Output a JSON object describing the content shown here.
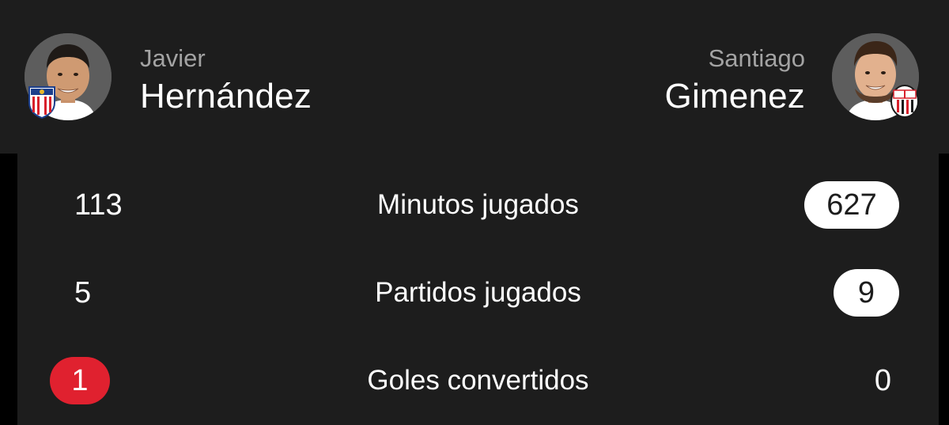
{
  "header": {
    "left_player": {
      "first_name": "Javier",
      "last_name": "Hernández",
      "club_crest_icon": "chivas-crest-icon"
    },
    "right_player": {
      "first_name": "Santiago",
      "last_name": "Gimenez",
      "club_crest_icon": "ac-milan-crest-icon"
    }
  },
  "stats": [
    {
      "label": "Minutos jugados",
      "left_value": "113",
      "right_value": "627",
      "highlight": "right",
      "highlight_color": "#ffffff"
    },
    {
      "label": "Partidos jugados",
      "left_value": "5",
      "right_value": "9",
      "highlight": "right",
      "highlight_color": "#ffffff"
    },
    {
      "label": "Goles convertidos",
      "left_value": "1",
      "right_value": "0",
      "highlight": "left",
      "highlight_color": "#e0212f"
    }
  ],
  "colors": {
    "background": "#000000",
    "panel": "#1d1d1d",
    "text_primary": "#ffffff",
    "text_secondary": "#a3a3a3",
    "accent_red": "#e0212f"
  }
}
